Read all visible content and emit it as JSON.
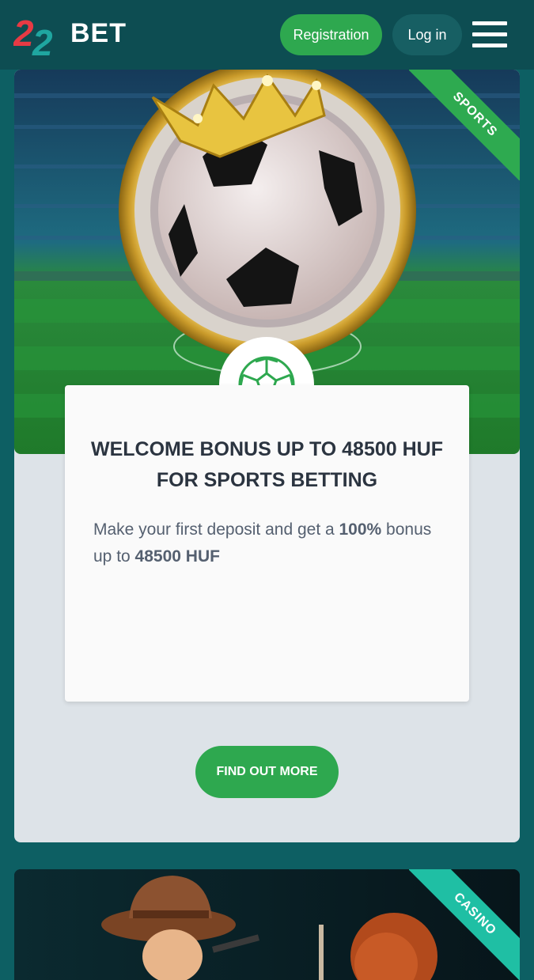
{
  "header": {
    "logo_text": "BET",
    "logo_digits": "22",
    "registration_label": "Registration",
    "login_label": "Log in"
  },
  "sports_card": {
    "ribbon": "SPORTS",
    "title": "WELCOME BONUS UP TO 48500 HUF FOR SPORTS BETTING",
    "text_before": "Make your first deposit and get a ",
    "percent": "100%",
    "text_middle": " bonus up to ",
    "amount": "48500 HUF",
    "button_label": "FIND OUT MORE"
  },
  "casino_card": {
    "ribbon": "CASINO"
  },
  "colors": {
    "brand_green": "#2ea84f",
    "header_bg": "#0d4d52",
    "page_bg": "#0d5f63",
    "casino_ribbon": "#1fbfa4"
  }
}
